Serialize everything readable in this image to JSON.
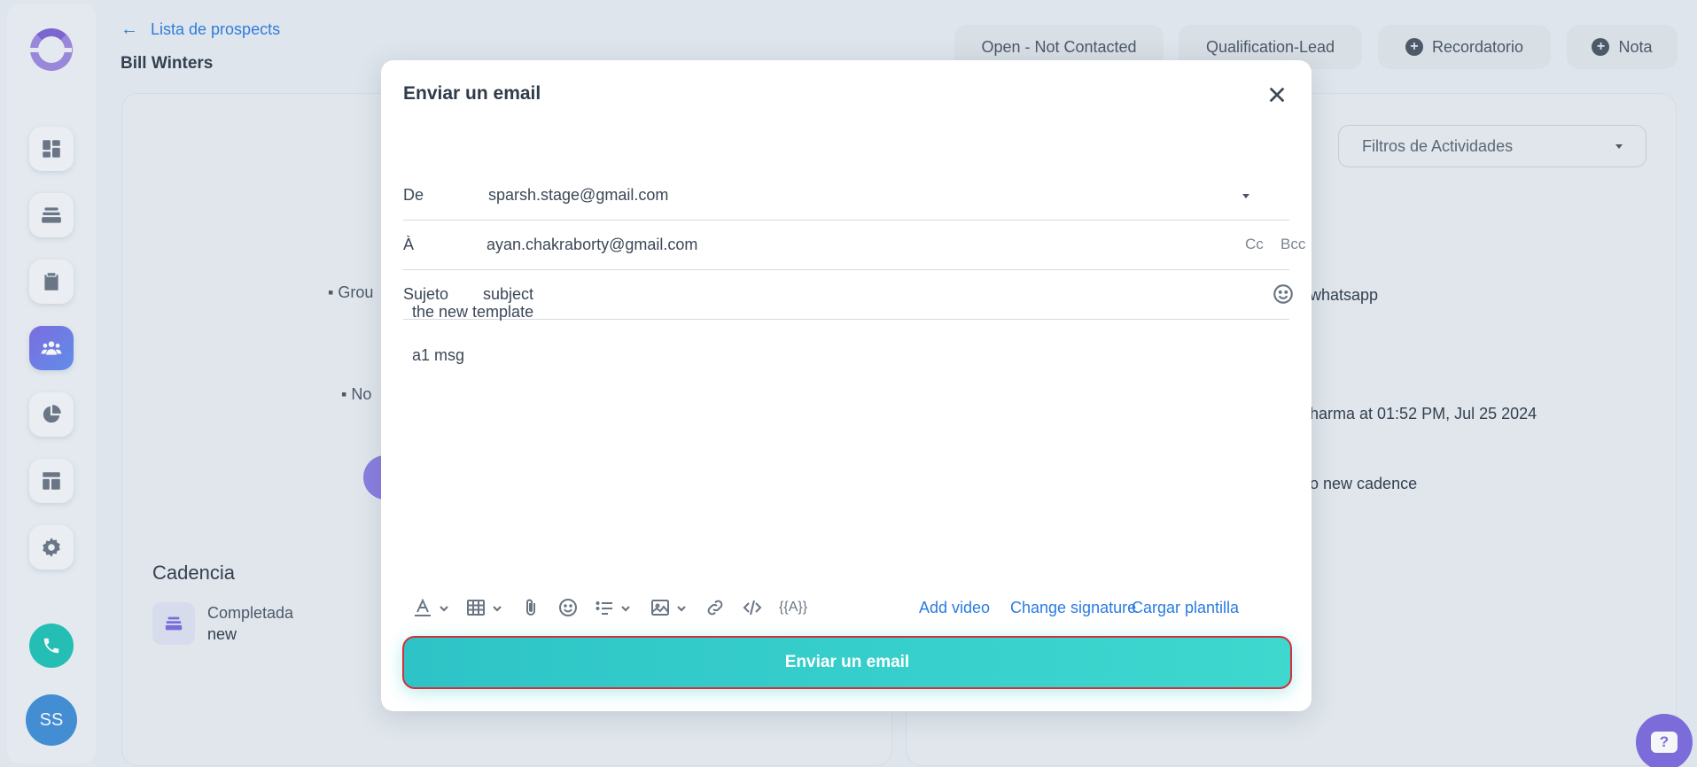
{
  "header": {
    "back_label": "Lista de prospects",
    "prospect_name": "Bill Winters",
    "chips": {
      "status": "Open - Not Contacted",
      "stage": "Qualification-Lead",
      "reminder": "Recordatorio",
      "note": "Nota"
    }
  },
  "sidebar": {
    "avatar_initials": "SS",
    "items": [
      "dashboard-icon",
      "layers-icon",
      "clipboard-icon",
      "users-icon",
      "pie-chart-icon",
      "layout-icon",
      "gear-icon"
    ]
  },
  "background": {
    "filter_label": "Filtros de Actividades",
    "group_partial": "Grou",
    "note_partial": "No",
    "whatsapp_partial": "whatsapp",
    "activity_partial": "harma at 01:52 PM, Jul 25 2024",
    "cadence_partial": "o new cadence",
    "cadence_title": "Cadencia",
    "cadence_status": "Completada",
    "cadence_name": "new"
  },
  "modal": {
    "title": "Enviar un email",
    "from_label": "De",
    "from_value": "sparsh.stage@gmail.com",
    "to_label": "À",
    "to_value": "ayan.chakraborty@gmail.com",
    "cc_label": "Cc",
    "bcc_label": "Bcc",
    "subject_label": "Sujeto",
    "subject_value": "subject",
    "body_lines": [
      "the new template",
      "a1 msg"
    ],
    "toolbar": {
      "variable_label": "{{A}}",
      "add_video": "Add video",
      "change_signature": "Change signature",
      "load_template": "Cargar plantilla"
    },
    "send_label": "Enviar un email"
  },
  "colors": {
    "accent_blue": "#2a7be0",
    "send_teal": "#2ec4c7",
    "send_border": "#d0303a",
    "brand_purple": "#7c6ae0"
  }
}
